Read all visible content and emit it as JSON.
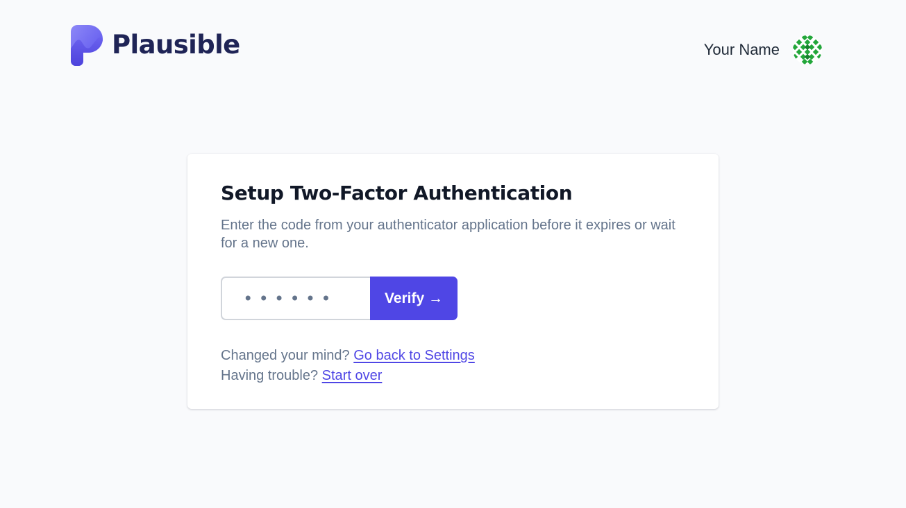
{
  "brand": {
    "name": "Plausible",
    "icon": "plausible-logo-icon",
    "color": "#5850ec"
  },
  "user": {
    "name": "Your Name",
    "avatar_icon": "green-geometric-avatar-icon"
  },
  "card": {
    "title": "Setup Two-Factor Authentication",
    "description": "Enter the code from your authenticator application before it expires or wait for a new one.",
    "code_input": {
      "value": "",
      "placeholder": "••••••"
    },
    "verify_label": "Verify →",
    "verify_color": "#4f46e5",
    "settings_prompt": "Changed your mind?",
    "settings_link": "Go back to Settings",
    "trouble_prompt": "Having trouble?",
    "trouble_link": "Start over"
  }
}
